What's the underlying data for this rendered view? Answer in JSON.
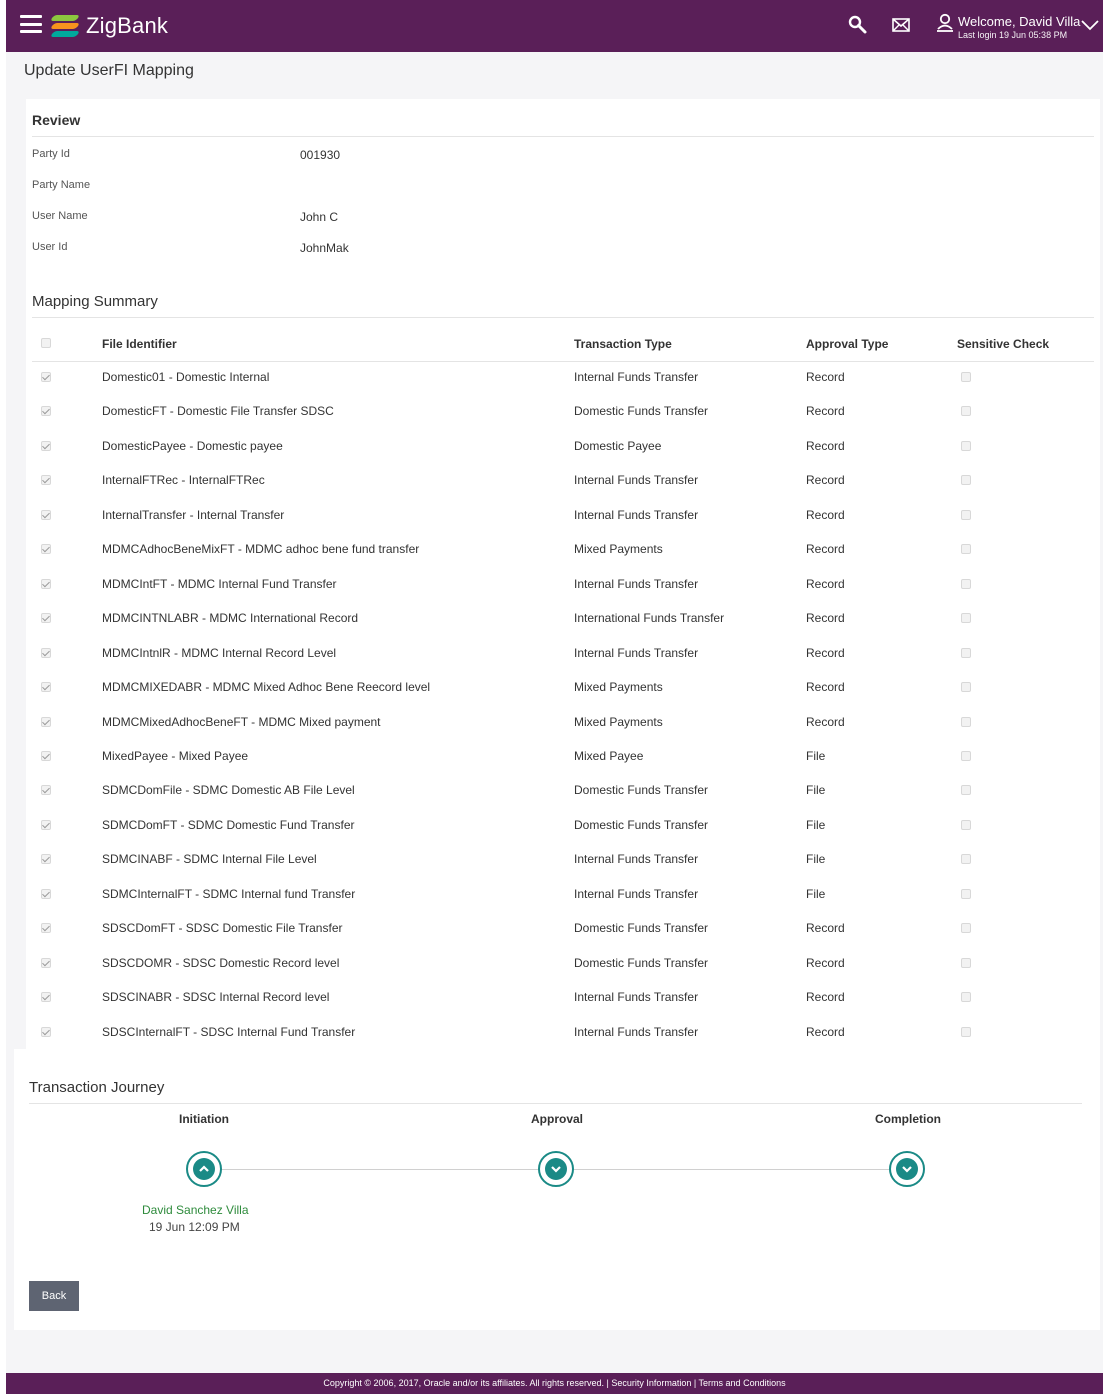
{
  "header": {
    "brand": "ZigBank",
    "welcome": "Welcome, David Villa",
    "last_login": "Last login 19 Jun 05:38 PM"
  },
  "page_title": "Update UserFI Mapping",
  "review": {
    "heading": "Review",
    "fields": [
      {
        "label": "Party Id",
        "value": "001930"
      },
      {
        "label": "Party Name",
        "value": ""
      },
      {
        "label": "User Name",
        "value": "John C"
      },
      {
        "label": "User Id",
        "value": "JohnMak"
      }
    ]
  },
  "mapping": {
    "heading": "Mapping Summary",
    "columns": [
      "File Identifier",
      "Transaction Type",
      "Approval Type",
      "Sensitive Check"
    ],
    "rows": [
      {
        "file": "Domestic01 - Domestic Internal",
        "type": "Internal Funds Transfer",
        "approval": "Record",
        "selected": true,
        "sensitive": false
      },
      {
        "file": "DomesticFT - Domestic File Transfer SDSC",
        "type": "Domestic Funds Transfer",
        "approval": "Record",
        "selected": true,
        "sensitive": false
      },
      {
        "file": "DomesticPayee - Domestic payee",
        "type": "Domestic Payee",
        "approval": "Record",
        "selected": true,
        "sensitive": false
      },
      {
        "file": "InternalFTRec - InternalFTRec",
        "type": "Internal Funds Transfer",
        "approval": "Record",
        "selected": true,
        "sensitive": false
      },
      {
        "file": "InternalTransfer - Internal Transfer",
        "type": "Internal Funds Transfer",
        "approval": "Record",
        "selected": true,
        "sensitive": false
      },
      {
        "file": "MDMCAdhocBeneMixFT - MDMC adhoc bene fund transfer",
        "type": "Mixed Payments",
        "approval": "Record",
        "selected": true,
        "sensitive": false
      },
      {
        "file": "MDMCIntFT - MDMC Internal Fund Transfer",
        "type": "Internal Funds Transfer",
        "approval": "Record",
        "selected": true,
        "sensitive": false
      },
      {
        "file": "MDMCINTNLABR - MDMC International Record",
        "type": "International Funds Transfer",
        "approval": "Record",
        "selected": true,
        "sensitive": false
      },
      {
        "file": "MDMCIntnlR - MDMC Internal Record Level",
        "type": "Internal Funds Transfer",
        "approval": "Record",
        "selected": true,
        "sensitive": false
      },
      {
        "file": "MDMCMIXEDABR - MDMC Mixed Adhoc Bene Reecord level",
        "type": "Mixed Payments",
        "approval": "Record",
        "selected": true,
        "sensitive": false
      },
      {
        "file": "MDMCMixedAdhocBeneFT - MDMC Mixed payment",
        "type": "Mixed Payments",
        "approval": "Record",
        "selected": true,
        "sensitive": false
      },
      {
        "file": "MixedPayee - Mixed Payee",
        "type": "Mixed Payee",
        "approval": "File",
        "selected": true,
        "sensitive": false
      },
      {
        "file": "SDMCDomFile - SDMC Domestic AB File Level",
        "type": "Domestic Funds Transfer",
        "approval": "File",
        "selected": true,
        "sensitive": false
      },
      {
        "file": "SDMCDomFT - SDMC Domestic Fund Transfer",
        "type": "Domestic Funds Transfer",
        "approval": "File",
        "selected": true,
        "sensitive": false
      },
      {
        "file": "SDMCINABF - SDMC Internal File Level",
        "type": "Internal Funds Transfer",
        "approval": "File",
        "selected": true,
        "sensitive": false
      },
      {
        "file": "SDMCInternalFT - SDMC Internal fund Transfer",
        "type": "Internal Funds Transfer",
        "approval": "File",
        "selected": true,
        "sensitive": false
      },
      {
        "file": "SDSCDomFT - SDSC Domestic File Transfer",
        "type": "Domestic Funds Transfer",
        "approval": "Record",
        "selected": true,
        "sensitive": false
      },
      {
        "file": "SDSCDOMR - SDSC Domestic Record level",
        "type": "Domestic Funds Transfer",
        "approval": "Record",
        "selected": true,
        "sensitive": false
      },
      {
        "file": "SDSCINABR - SDSC Internal Record level",
        "type": "Internal Funds Transfer",
        "approval": "Record",
        "selected": true,
        "sensitive": false
      },
      {
        "file": "SDSCInternalFT - SDSC Internal Fund Transfer",
        "type": "Internal Funds Transfer",
        "approval": "Record",
        "selected": true,
        "sensitive": false
      }
    ]
  },
  "journey": {
    "heading": "Transaction Journey",
    "steps": [
      "Initiation",
      "Approval",
      "Completion"
    ],
    "initiated_by": "David Sanchez Villa",
    "initiated_at": "19 Jun 12:09 PM"
  },
  "actions": {
    "back": "Back"
  },
  "footer": "Copyright © 2006, 2017, Oracle and/or its affiliates. All rights reserved. | Security Information | Terms and Conditions",
  "colors": {
    "brand": "#5a1f58",
    "accent": "#1a8a86",
    "button": "#5e6472",
    "actor": "#2e8b3c"
  }
}
